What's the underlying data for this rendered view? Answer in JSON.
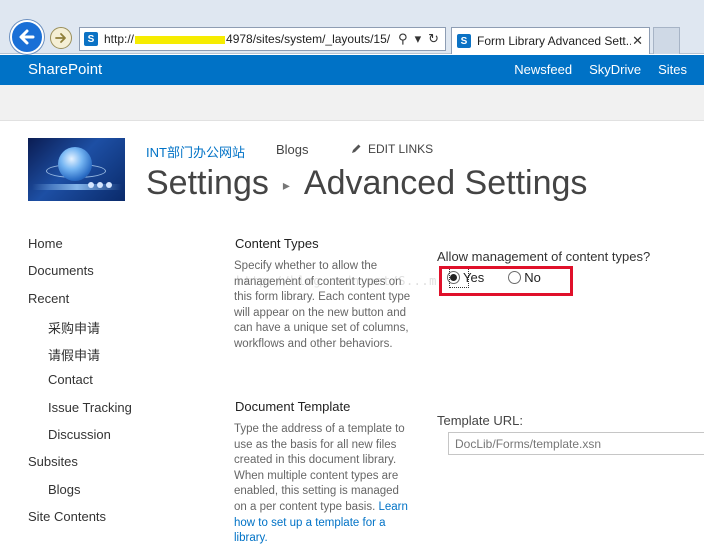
{
  "browser": {
    "url": "http://p...:4978/sites/system/_layouts/15/",
    "url_prefix": "http://",
    "url_suffix": "4978/sites/system/_layouts/15/",
    "tab_title": "Form Library Advanced Sett...",
    "search_glyph": "⚲",
    "dropdown_glyph": "▾",
    "refresh_glyph": "↻",
    "close_glyph": "✕"
  },
  "suite": {
    "brand": "SharePoint",
    "links": [
      "Newsfeed",
      "SkyDrive",
      "Sites"
    ]
  },
  "header": {
    "site_name": "INT部门办公网站",
    "blogs": "Blogs",
    "edit_links": "EDIT LINKS",
    "title_parent": "Settings",
    "title_sep": "▸",
    "title_current": "Advanced Settings"
  },
  "leftnav": {
    "items": [
      {
        "label": "Home",
        "level": 0
      },
      {
        "label": "Documents",
        "level": 0
      },
      {
        "label": "Recent",
        "level": 0
      },
      {
        "label": "采购申请",
        "level": 1
      },
      {
        "label": "请假申请",
        "level": 1
      },
      {
        "label": "Contact",
        "level": 1
      },
      {
        "label": "Issue Tracking",
        "level": 1
      },
      {
        "label": "Discussion",
        "level": 1
      },
      {
        "label": "Subsites",
        "level": 0
      },
      {
        "label": "Blogs",
        "level": 1
      },
      {
        "label": "Site Contents",
        "level": 0
      }
    ]
  },
  "content_types": {
    "title": "Content Types",
    "description": "Specify whether to allow the management of content types on this form library. Each content type will appear on the new button and can have a unique set of columns, workflows and other behaviors.",
    "question": "Allow management of content types?",
    "options": [
      {
        "label": "Yes",
        "selected": true
      },
      {
        "label": "No",
        "selected": false
      }
    ]
  },
  "document_template": {
    "title": "Document Template",
    "description": "Type the address of a template to use as the basis for all new files created in this document library. When multiple content types are enabled, this setting is managed on a per content type basis.",
    "link_text": "Learn how to set up a template for a library.",
    "url_label": "Template URL:",
    "url_value": "DocLib/Forms/template.xsn"
  },
  "watermark": "http://blog.csdn.net/S...m",
  "colors": {
    "suite_blue": "#0072c6",
    "highlight_red": "#e0102a",
    "link_blue": "#0072c6"
  }
}
